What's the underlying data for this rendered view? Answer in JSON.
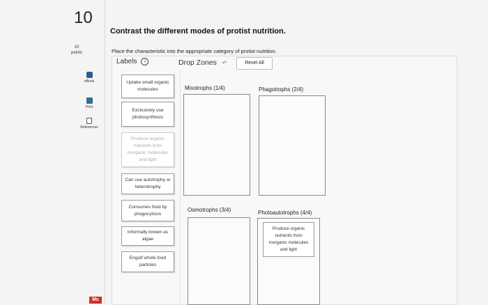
{
  "question": {
    "number": "10",
    "points_value": "10",
    "points_label": "points",
    "title": "Contrast the different modes of protist nutrition.",
    "instruction": "Place the characteristic into the appropriate category of protist nutrition."
  },
  "tools": {
    "ebook": "eBook",
    "print": "Print",
    "references": "References"
  },
  "logo_text": "Mc",
  "header": {
    "labels_title": "Labels",
    "info_glyph": "i",
    "dropzones_title": "Drop Zones",
    "back_glyph": "↶",
    "reset_label": "Reset All"
  },
  "labels": [
    "Uptake small organic molecules",
    "Exclusively use photosynthesis",
    "Produce organic nutrients from inorganic molecules and light",
    "Can use autotrophy or heterotrophy",
    "Consumes food by phagocytosis",
    "Informally known as algae",
    "Engulf whole food particles"
  ],
  "zones": {
    "mixotrophs": "Mixotrophs  (1/4)",
    "phagotrophs": "Phagotrophs (2/4)",
    "osmotrophs": "Osmotrophs (3/4)",
    "photoautotrophs": "Photoautotrophs (4/4)"
  },
  "placed": {
    "photoautotrophs_item": "Produce organic nutrients from inorganic molecules and light"
  }
}
